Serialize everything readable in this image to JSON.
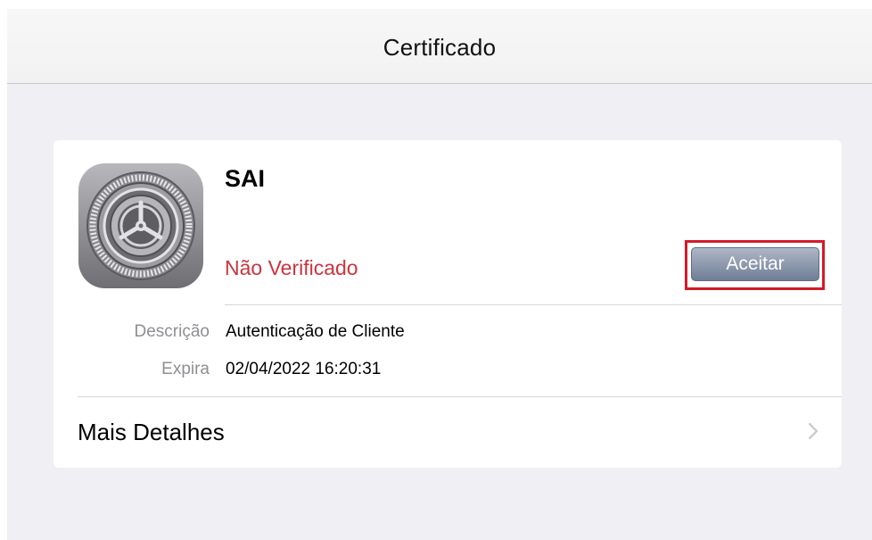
{
  "nav": {
    "title": "Certificado"
  },
  "certificate": {
    "name": "SAI",
    "status": "Não Verificado",
    "status_color": "#c9353f",
    "icon": "settings-gear-icon"
  },
  "actions": {
    "accept_label": "Aceitar",
    "highlight_color": "#d41a2a"
  },
  "details": {
    "description_label": "Descrição",
    "description_value": "Autenticação de Cliente",
    "expires_label": "Expira",
    "expires_value": "02/04/2022 16:20:31"
  },
  "more": {
    "label": "Mais Detalhes",
    "icon": "chevron-right-icon"
  }
}
